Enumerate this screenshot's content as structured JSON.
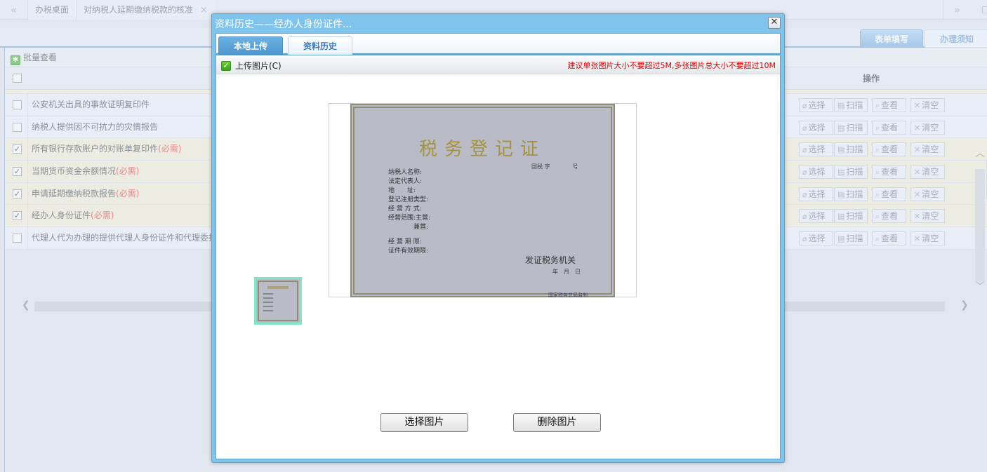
{
  "topbar": {
    "nav_prev": "«",
    "nav_next": "»",
    "tabs": [
      {
        "label": "办税桌面"
      },
      {
        "label": "对纳税人延期缴纳税款的核准",
        "close": "×"
      }
    ]
  },
  "right_tabs": [
    {
      "label": "表单填写",
      "active": true
    },
    {
      "label": "办理须知",
      "active": false
    }
  ],
  "panel": {
    "title": "批量查看",
    "header": {
      "ops_label": "操作"
    },
    "required_suffix": "(必需)",
    "rows": [
      {
        "label": "公安机关出具的事故证明复印件",
        "checked": false,
        "required": false
      },
      {
        "label": "纳税人提供因不可抗力的灾情报告",
        "checked": false,
        "required": false
      },
      {
        "label": "所有银行存款账户的对账单复印件",
        "checked": true,
        "required": true
      },
      {
        "label": "当期货币资金余额情况",
        "checked": true,
        "required": true
      },
      {
        "label": "申请延期缴纳税款报告",
        "checked": true,
        "required": true
      },
      {
        "label": "经办人身份证件",
        "checked": true,
        "required": true
      },
      {
        "label": "代理人代为办理的提供代理人身份证件和代理委托",
        "checked": false,
        "required": false
      }
    ],
    "row_actions": [
      {
        "label": "选择",
        "icon": "paperclip-icon"
      },
      {
        "label": "扫描",
        "icon": "scanner-icon"
      },
      {
        "label": "查看",
        "icon": "view-icon"
      },
      {
        "label": "清空",
        "icon": "clear-icon"
      }
    ]
  },
  "modal": {
    "title": "资料历史——经办人身份证件...",
    "close": "✕",
    "tabs": [
      {
        "label": "本地上传",
        "active": true
      },
      {
        "label": "资料历史",
        "active": false
      }
    ],
    "toolbar": {
      "upload_label": "上传图片(C)",
      "warning": "建议单张图片大小不要超过5M,多张图片总大小不要超过10M"
    },
    "preview": {
      "title": "税务登记证",
      "number": "国税 字　　　　号",
      "fields": [
        "纳税人名称:",
        "法定代表人:",
        "地　　址:",
        "登记注册类型:",
        "经 营 方 式:",
        "经营范围:主营:",
        "　　　　兼营:",
        "经 营 期 限:",
        "证件有效期限:"
      ],
      "issuer": "发证税务机关",
      "date": "年　月　日",
      "footer": "国家税务总局监制"
    },
    "buttons": {
      "select": "选择图片",
      "delete": "删除图片"
    }
  }
}
